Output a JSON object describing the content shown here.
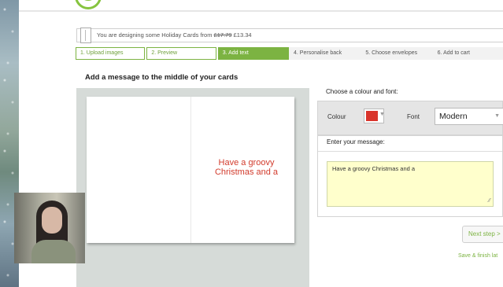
{
  "design_bar": {
    "prefix": "You are designing some Holiday Cards from ",
    "old_price": "£17.79",
    "new_price": " £13.34"
  },
  "steps": [
    {
      "label": "1. Upload images",
      "state": "done"
    },
    {
      "label": "2. Preview",
      "state": "done"
    },
    {
      "label": "3. Add text",
      "state": "active"
    },
    {
      "label": "4. Personalise back",
      "state": "todo"
    },
    {
      "label": "5. Choose envelopes",
      "state": "todo"
    },
    {
      "label": "6. Add to cart",
      "state": "todo"
    }
  ],
  "heading": "Add a message to the middle of your cards",
  "card": {
    "message_line1": "Have a groovy",
    "message_line2": "Christmas and a"
  },
  "options": {
    "title": "Choose a colour and font:",
    "colour_label": "Colour",
    "colour_value": "#d9342b",
    "font_label": "Font",
    "font_value": "Modern"
  },
  "message": {
    "label": "Enter your message:",
    "text": "Have a groovy Christmas and a"
  },
  "actions": {
    "next": "Next step >",
    "save": "Save & finish lat"
  },
  "colors": {
    "accent": "#7cb342",
    "message_text": "#d23b2c"
  }
}
